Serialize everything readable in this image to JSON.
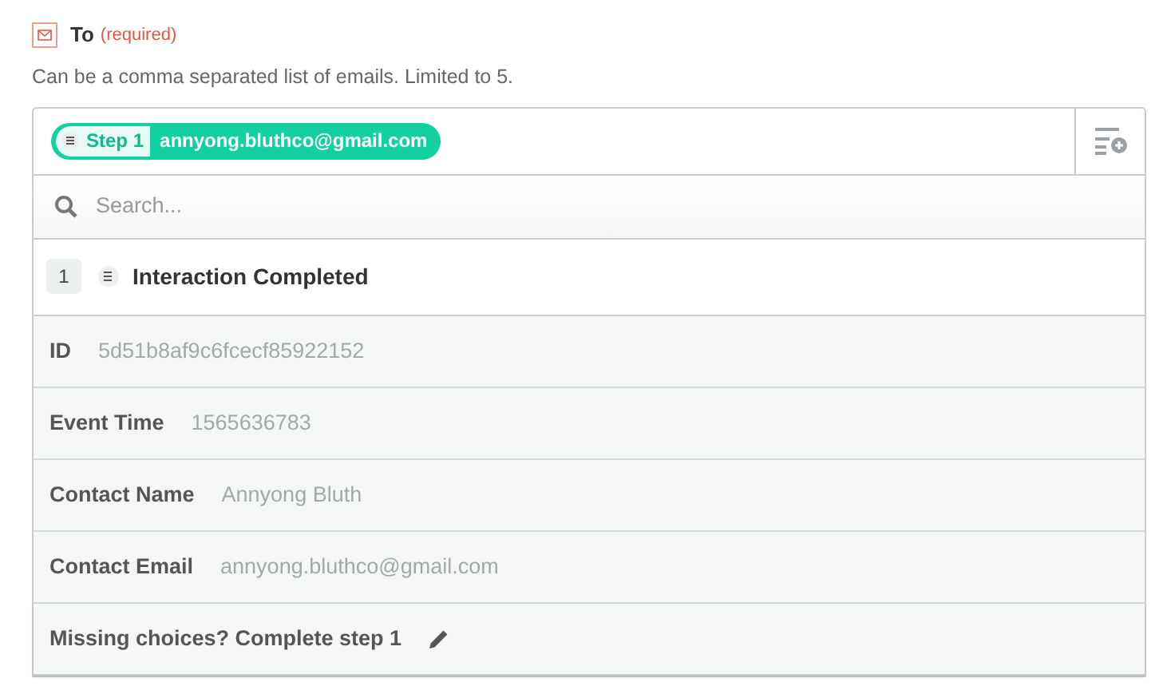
{
  "field": {
    "label": "To",
    "required_note": "(required)",
    "help": "Can be a comma separated list of emails. Limited to 5."
  },
  "token": {
    "step": "Step 1",
    "value": "annyong.bluthco@gmail.com"
  },
  "search": {
    "placeholder": "Search..."
  },
  "step_header": {
    "number": "1",
    "title": "Interaction Completed"
  },
  "choices": [
    {
      "label": "ID",
      "value": "5d51b8af9c6fcecf85922152"
    },
    {
      "label": "Event Time",
      "value": "1565636783"
    },
    {
      "label": "Contact Name",
      "value": "Annyong Bluth"
    },
    {
      "label": "Contact Email",
      "value": "annyong.bluthco@gmail.com"
    }
  ],
  "footer": {
    "text": "Missing choices? Complete step 1"
  }
}
